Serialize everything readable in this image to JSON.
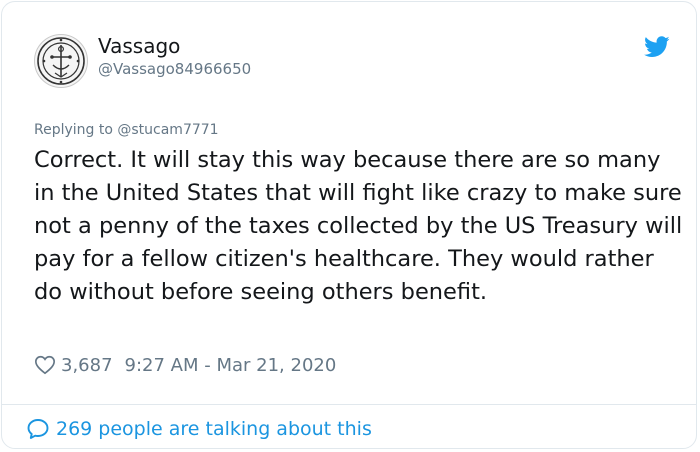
{
  "author": {
    "display_name": "Vassago",
    "handle": "@Vassago84966650",
    "avatar_icon": "sigil-avatar-icon"
  },
  "brand": {
    "icon": "twitter-bird-icon",
    "color": "#1da1f2"
  },
  "reply": {
    "text": "Replying to @stucam7771"
  },
  "tweet": {
    "text": "Correct. It will stay this way because there are so many in the United States that will fight like crazy to make sure not a penny of the taxes collected by the US Treasury will pay for a fellow citizen's healthcare. They would rather do without before seeing others benefit."
  },
  "meta": {
    "like_icon": "heart-icon",
    "likes": "3,687",
    "timestamp": "9:27 AM - Mar 21, 2020"
  },
  "footer": {
    "icon": "speech-bubble-icon",
    "talking_text": "269 people are talking about this",
    "link_color": "#1b95e0"
  }
}
